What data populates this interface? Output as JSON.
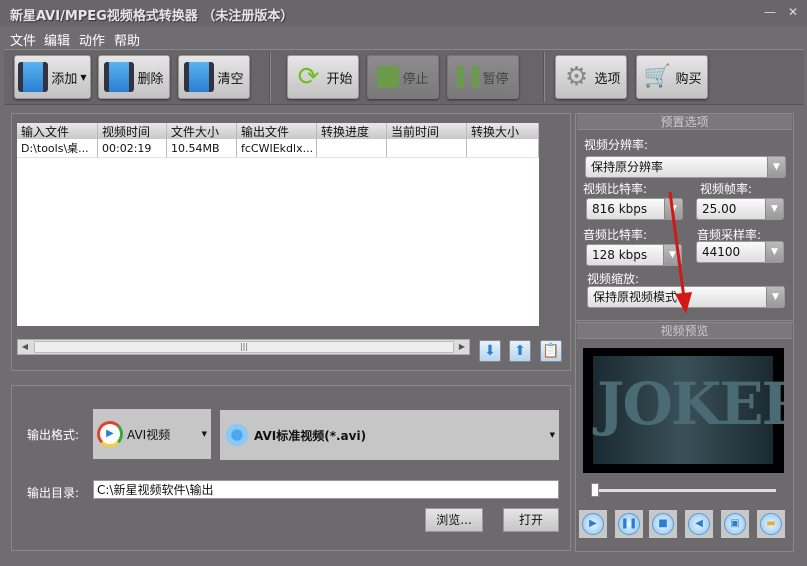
{
  "window": {
    "title": "新星AVI/MPEG视频格式转换器 （未注册版本）",
    "minimize": "—",
    "close": "✕"
  },
  "menu": [
    "文件",
    "编辑",
    "动作",
    "帮助"
  ],
  "toolbar": {
    "add": "添加",
    "delete": "删除",
    "clear": "清空",
    "start": "开始",
    "stop": "停止",
    "pause": "暂停",
    "options": "选项",
    "buy": "购买"
  },
  "table": {
    "columns": [
      "输入文件",
      "视频时间",
      "文件大小",
      "输出文件",
      "转换进度",
      "当前时间",
      "转换大小"
    ],
    "rows": [
      [
        "D:\\tools\\桌...",
        "00:02:19",
        "10.54MB",
        "fcCWIEkdlx...",
        "",
        "",
        ""
      ]
    ]
  },
  "scroll": {
    "thumb": "|||"
  },
  "output": {
    "format_label": "输出格式:",
    "format": "AVI视频",
    "profile": "AVI标准视频(*.avi)",
    "dir_label": "输出目录:",
    "dir": "C:\\新星视频软件\\输出",
    "browse": "浏览...",
    "open": "打开"
  },
  "presets": {
    "header": "预置选项",
    "resolution_label": "视频分辨率:",
    "resolution": "保持原分辨率",
    "vbitrate_label": "视频比特率:",
    "vbitrate": "816 kbps",
    "framerate_label": "视频帧率:",
    "framerate": "25.00",
    "abitrate_label": "音频比特率:",
    "abitrate": "128 kbps",
    "samplerate_label": "音频采样率:",
    "samplerate": "44100",
    "scale_label": "视频缩放:",
    "scale": "保持原视频模式"
  },
  "preview": {
    "header": "视频预览",
    "frame_text": "JOKER",
    "progress": 0
  },
  "colors": {
    "annotation_arrow": "#d01818",
    "accent": "#2a7ed0"
  }
}
